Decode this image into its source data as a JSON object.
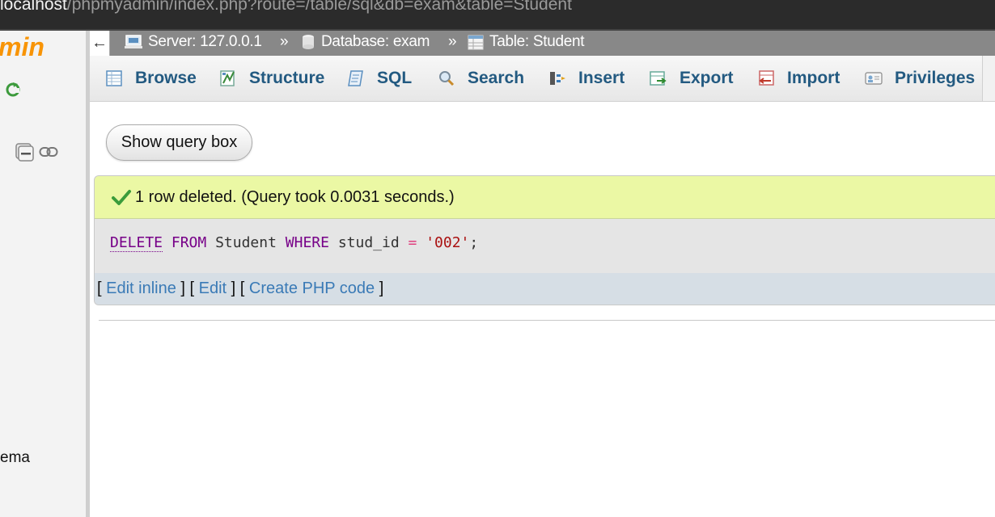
{
  "browser": {
    "url_host": "localhost",
    "url_rest": "/phpmyadmin/index.php?route=/table/sql&db=exam&table=Student"
  },
  "nav": {
    "logo_text": "min",
    "bottom_text": "ema",
    "back_arrow": "←"
  },
  "breadcrumb": {
    "server": "Server: 127.0.0.1",
    "database": "Database: exam",
    "table": "Table: Student",
    "separator": "»"
  },
  "tabs": [
    {
      "label": "Browse",
      "icon": "browse-icon"
    },
    {
      "label": "Structure",
      "icon": "structure-icon"
    },
    {
      "label": "SQL",
      "icon": "sql-icon"
    },
    {
      "label": "Search",
      "icon": "search-icon"
    },
    {
      "label": "Insert",
      "icon": "insert-icon"
    },
    {
      "label": "Export",
      "icon": "export-icon"
    },
    {
      "label": "Import",
      "icon": "import-icon"
    },
    {
      "label": "Privileges",
      "icon": "privileges-icon"
    }
  ],
  "main": {
    "show_query_button": "Show query box",
    "success_message": "1 row deleted. (Query took 0.0031 seconds.)",
    "sql": {
      "delete": "DELETE",
      "from": "FROM",
      "table": "Student",
      "where": "WHERE",
      "column": "stud_id",
      "operator": "=",
      "value": "'002'",
      "terminator": ";"
    },
    "actions": {
      "open1": "[ ",
      "edit_inline": "Edit inline",
      "mid1": " ] [ ",
      "edit": "Edit",
      "mid2": " ] [ ",
      "create_php": "Create PHP code",
      "close": " ]"
    }
  },
  "colors": {
    "accent_orange": "#f89406",
    "tab_text": "#235a81",
    "success_bg": "#ebf8a4",
    "link": "#3a7ab6",
    "breadcrumb_bg": "#888888"
  }
}
